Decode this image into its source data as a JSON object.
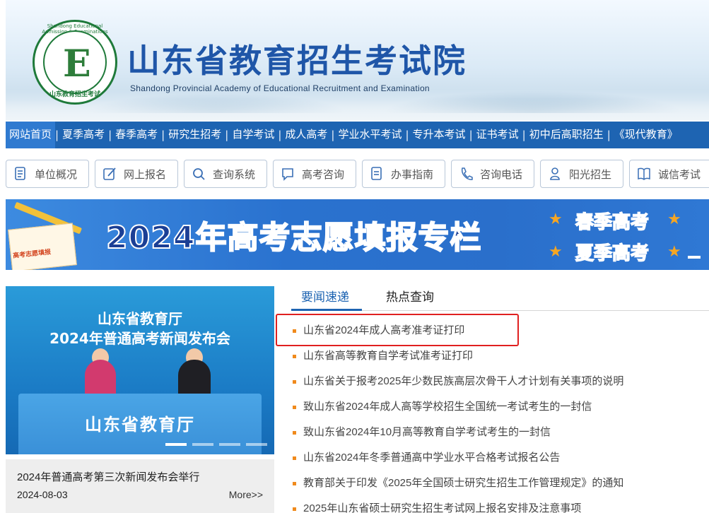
{
  "header": {
    "title_cn": "山东省教育招生考试院",
    "title_en": "Shandong Provincial Academy of Educational Recruitment and Examination",
    "logo": {
      "ring_text_top": "Shandong Educational Admission & Examinations",
      "ring_text_bottom": "山东教育招生考试",
      "letter": "E"
    }
  },
  "nav": {
    "items": [
      {
        "label": "网站首页",
        "active": true
      },
      {
        "label": "夏季高考"
      },
      {
        "label": "春季高考"
      },
      {
        "label": "研究生招考"
      },
      {
        "label": "自学考试"
      },
      {
        "label": "成人高考"
      },
      {
        "label": "学业水平考试"
      },
      {
        "label": "专升本考试"
      },
      {
        "label": "证书考试"
      },
      {
        "label": "初中后高职招生"
      },
      {
        "label": "《现代教育》"
      }
    ],
    "separator": "|"
  },
  "quick_links": [
    {
      "label": "单位概况",
      "icon": "document-icon"
    },
    {
      "label": "网上报名",
      "icon": "edit-icon"
    },
    {
      "label": "查询系统",
      "icon": "search-icon"
    },
    {
      "label": "高考咨询",
      "icon": "chat-icon"
    },
    {
      "label": "办事指南",
      "icon": "guide-icon"
    },
    {
      "label": "咨询电话",
      "icon": "phone-icon"
    },
    {
      "label": "阳光招生",
      "icon": "user-icon"
    },
    {
      "label": "诚信考试",
      "icon": "book-icon"
    }
  ],
  "banner": {
    "headline": "2024年高考志愿填报专栏",
    "spring": "春季高考",
    "summer": "夏季高考",
    "paper_tag": "高考志愿填报"
  },
  "carousel": {
    "slide_line1": "山东省教育厅",
    "slide_line2": "2024年普通高考新闻发布会",
    "desk_label": "山东省教育厅",
    "active_slide": 1,
    "slide_count": 4,
    "caption_title": "2024年普通高考第三次新闻发布会举行",
    "caption_date": "2024-08-03",
    "more": "More>>"
  },
  "news": {
    "tabs": [
      "要闻速递",
      "热点查询"
    ],
    "active_tab": 0,
    "items": [
      "山东省2024年成人高考准考证打印",
      "山东省高等教育自学考试准考证打印",
      "山东省关于报考2025年少数民族高层次骨干人才计划有关事项的说明",
      "致山东省2024年成人高等学校招生全国统一考试考生的一封信",
      "致山东省2024年10月高等教育自学考试考生的一封信",
      "山东省2024年冬季普通高中学业水平合格考试报名公告",
      "教育部关于印发《2025年全国硕士研究生招生工作管理规定》的通知",
      "2025年山东省硕士研究生招生考试网上报名安排及注意事项"
    ]
  },
  "colors": {
    "nav_bg": "#1e64b2",
    "accent_orange": "#f08a1c",
    "highlight_red": "#e02020"
  }
}
